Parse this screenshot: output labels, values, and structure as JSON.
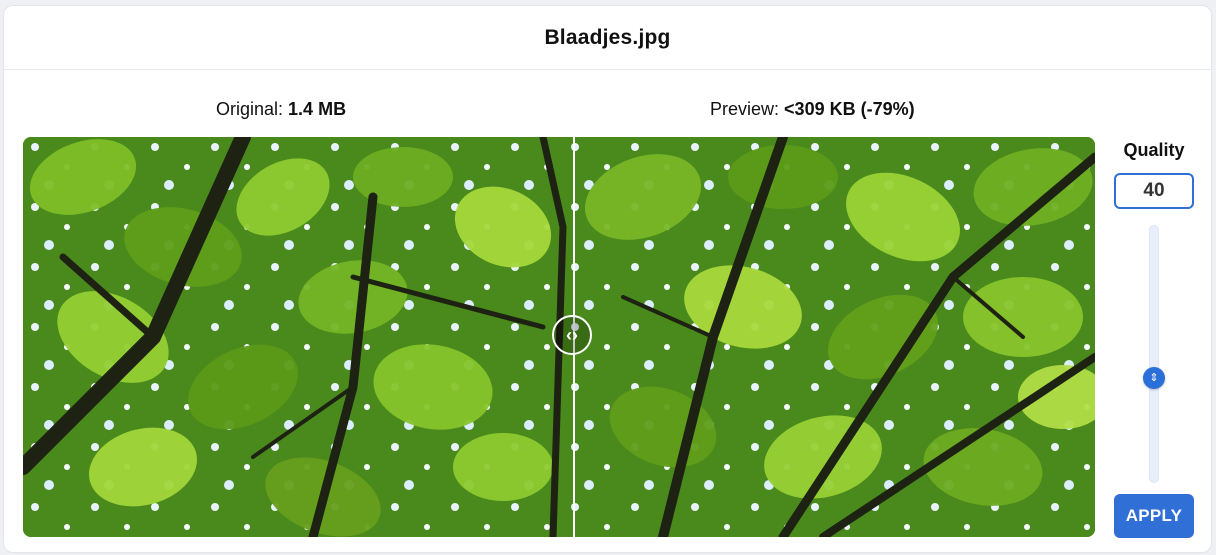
{
  "dialog": {
    "title": "Blaadjes.jpg"
  },
  "sizes": {
    "original_label": "Original:",
    "original_value": "1.4 MB",
    "preview_label": "Preview:",
    "preview_value": "<309 KB (-79%)"
  },
  "compare": {
    "split_fraction": 0.515,
    "handle_icon": "left-right-chevrons-icon"
  },
  "quality": {
    "label": "Quality",
    "value": "40",
    "slider_min": 0,
    "slider_max": 100,
    "slider_value": 40,
    "apply_label": "APPLY"
  },
  "colors": {
    "accent": "#2f6fd6",
    "leaf_light": "#9fd23a",
    "leaf_dark": "#2f6410",
    "branch": "#1d2212"
  }
}
